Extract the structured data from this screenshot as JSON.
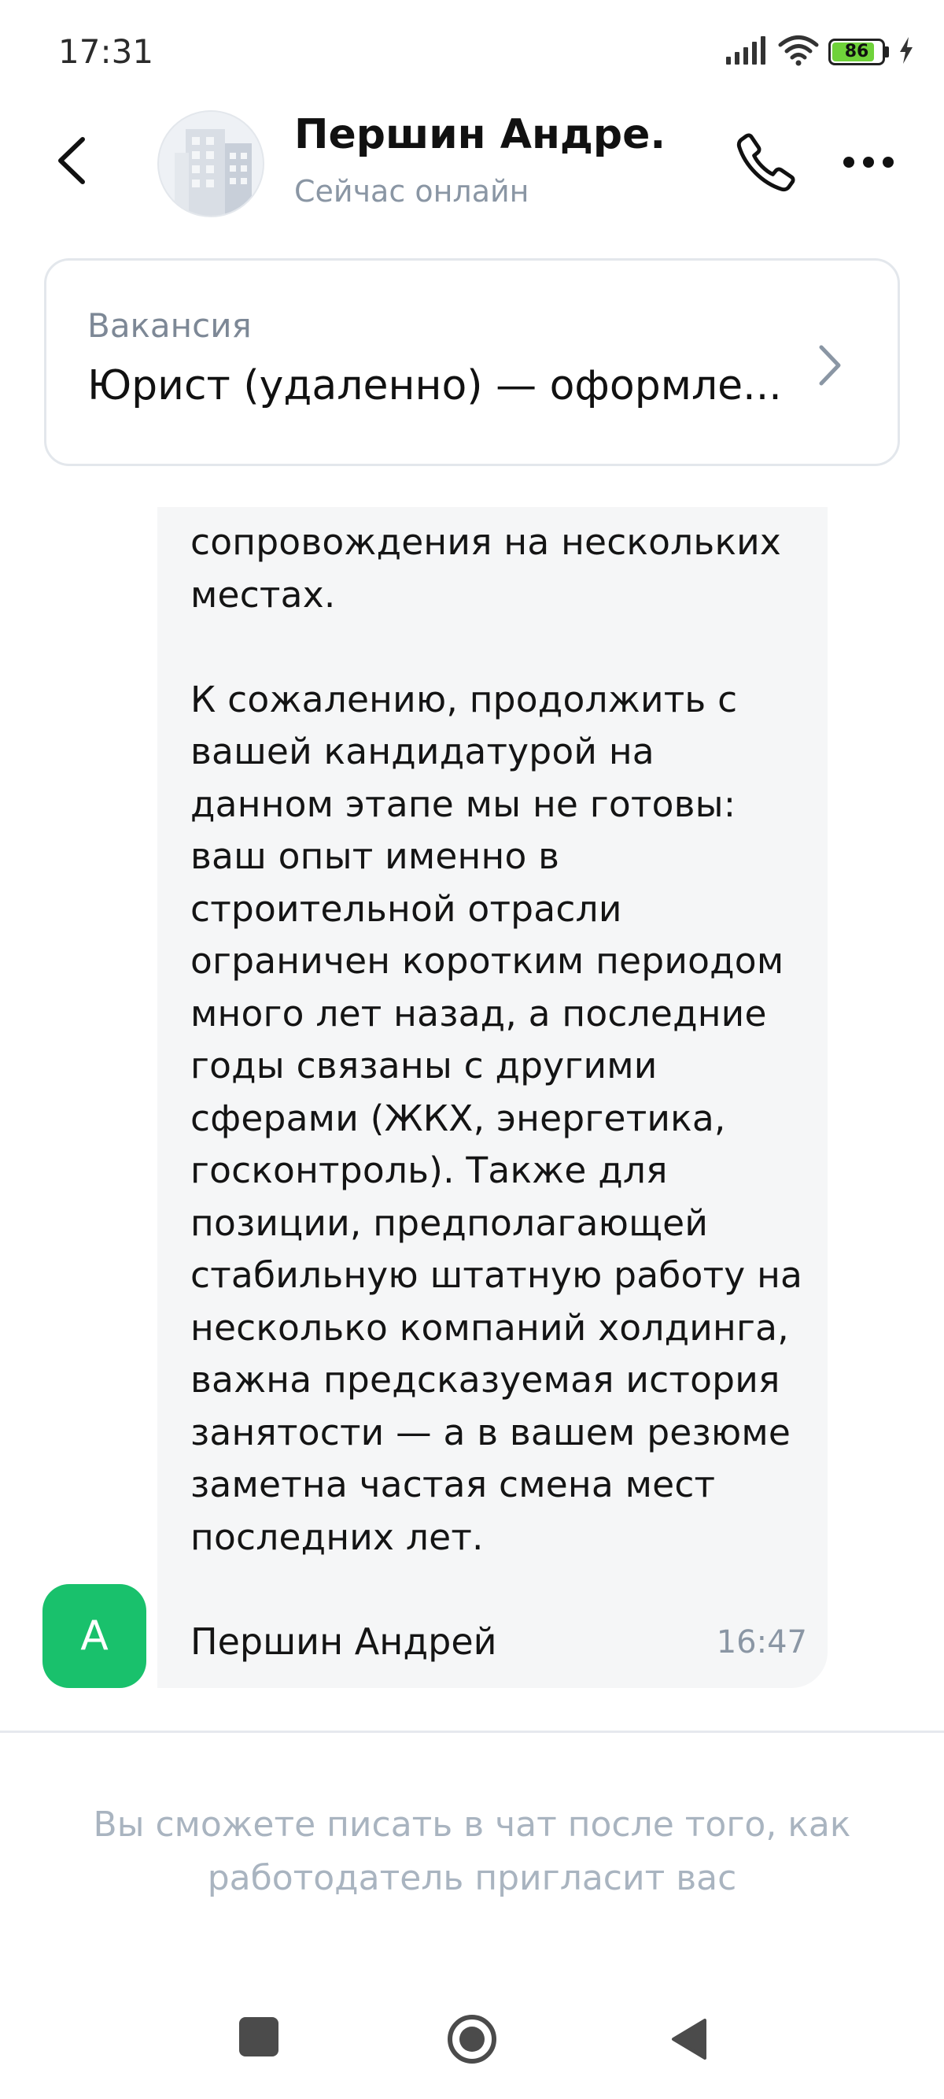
{
  "status_bar": {
    "time": "17:31",
    "battery_level": "86",
    "battery_percent": 86,
    "icons": [
      "signal-icon",
      "wifi-icon",
      "battery-icon",
      "charging-icon"
    ]
  },
  "header": {
    "back_icon": "back-arrow-icon",
    "contact_name": "Першин Андре...",
    "status": "Сейчас онлайн",
    "call_icon": "phone-icon",
    "more_icon": "more-horizontal-icon"
  },
  "vacancy": {
    "label": "Вакансия",
    "title": "Юрист (удаленно) — оформле...",
    "chevron_icon": "chevron-right-icon"
  },
  "message": {
    "text": "сопровождения на нескольких\nместах.\n\nК сожалению, продолжить с\nвашей кандидатурой на\nданном этапе мы не готовы:\nваш опыт именно в\nстроительной отрасли\nограничен коротким периодом\nмного лет назад, а последние\nгоды связаны с другими\nсферами (ЖКХ, энергетика,\nгосконтроль). Также для\nпозиции, предполагающей\nстабильную штатную работу на\nнесколько компаний холдинга,\nважна предсказуемая история\nзанятости — а в вашем резюме\nзаметна частая смена мест\nпоследних лет.",
    "author": "Першин Андрей",
    "time": "16:47",
    "avatar_letter": "А"
  },
  "notice": "Вы сможете писать в чат после того, как\nработодатель пригласит вас",
  "colors": {
    "accent_green": "#19c16c",
    "muted_text": "#8a96a4",
    "bubble_bg": "#f5f6f7",
    "battery_green": "#6fd23a"
  }
}
